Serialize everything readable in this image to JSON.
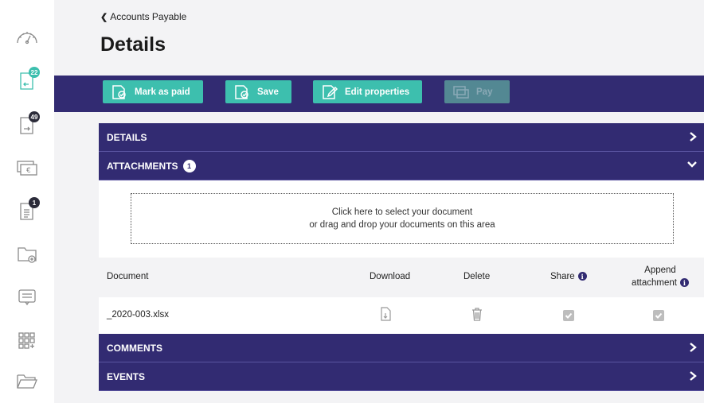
{
  "sidebar": {
    "items": [
      {
        "icon": "gauge-icon"
      },
      {
        "icon": "invoice-in-icon",
        "badge": "22"
      },
      {
        "icon": "invoice-out-icon",
        "badge": "49"
      },
      {
        "icon": "euro-bills-icon"
      },
      {
        "icon": "list-document-icon",
        "badge": "1"
      },
      {
        "icon": "folder-add-icon"
      },
      {
        "icon": "message-icon"
      },
      {
        "icon": "grid-add-icon"
      },
      {
        "icon": "folder-open-icon"
      }
    ]
  },
  "header": {
    "breadcrumb": "Accounts Payable",
    "title": "Details"
  },
  "toolbar": {
    "mark_as_paid": "Mark as paid",
    "save": "Save",
    "edit_properties": "Edit properties",
    "pay": "Pay"
  },
  "sections": {
    "details": "DETAILS",
    "attachments": "ATTACHMENTS",
    "attachments_count": "1",
    "comments": "COMMENTS",
    "events": "EVENTS"
  },
  "dropzone": {
    "line1": "Click here to select your document",
    "line2": "or drag and drop your documents on this area"
  },
  "table": {
    "headers": {
      "document": "Document",
      "download": "Download",
      "delete": "Delete",
      "share": "Share",
      "append_line1": "Append",
      "append_line2": "attachment"
    },
    "rows": [
      {
        "document": "_2020-003.xlsx",
        "share": true,
        "append": true
      }
    ]
  },
  "colors": {
    "navy": "#322b72",
    "teal": "#3dbfae"
  }
}
